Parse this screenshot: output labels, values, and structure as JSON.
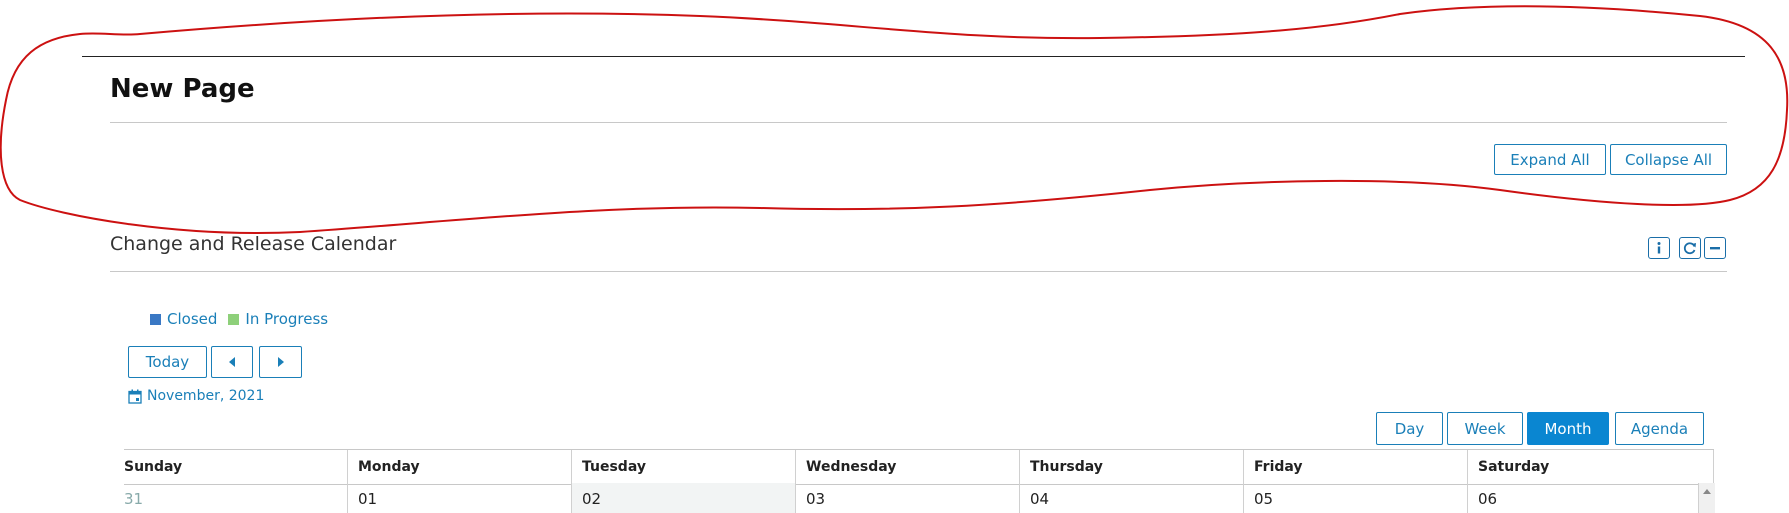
{
  "page": {
    "title": "New Page"
  },
  "toolbar": {
    "expand_all": "Expand All",
    "collapse_all": "Collapse All"
  },
  "widget": {
    "title": "Change and Release Calendar",
    "icons": [
      "info-icon",
      "refresh-icon",
      "minimize-icon"
    ]
  },
  "legend": {
    "items": [
      {
        "label": "Closed",
        "color": "#3a78c4"
      },
      {
        "label": "In Progress",
        "color": "#8ed07a"
      }
    ]
  },
  "nav": {
    "today": "Today",
    "prev_icon": "triangle-left-icon",
    "next_icon": "triangle-right-icon"
  },
  "period": {
    "label": "November, 2021"
  },
  "views": {
    "day": "Day",
    "week": "Week",
    "month": "Month",
    "agenda": "Agenda",
    "active": "Month"
  },
  "calendar": {
    "days": [
      "Sunday",
      "Monday",
      "Tuesday",
      "Wednesday",
      "Thursday",
      "Friday",
      "Saturday"
    ],
    "first_row": [
      "31",
      "01",
      "02",
      "03",
      "04",
      "05",
      "06"
    ]
  },
  "colors": {
    "accent": "#1a7fb8",
    "active": "#0a86d1",
    "annotation": "#cc1111"
  }
}
